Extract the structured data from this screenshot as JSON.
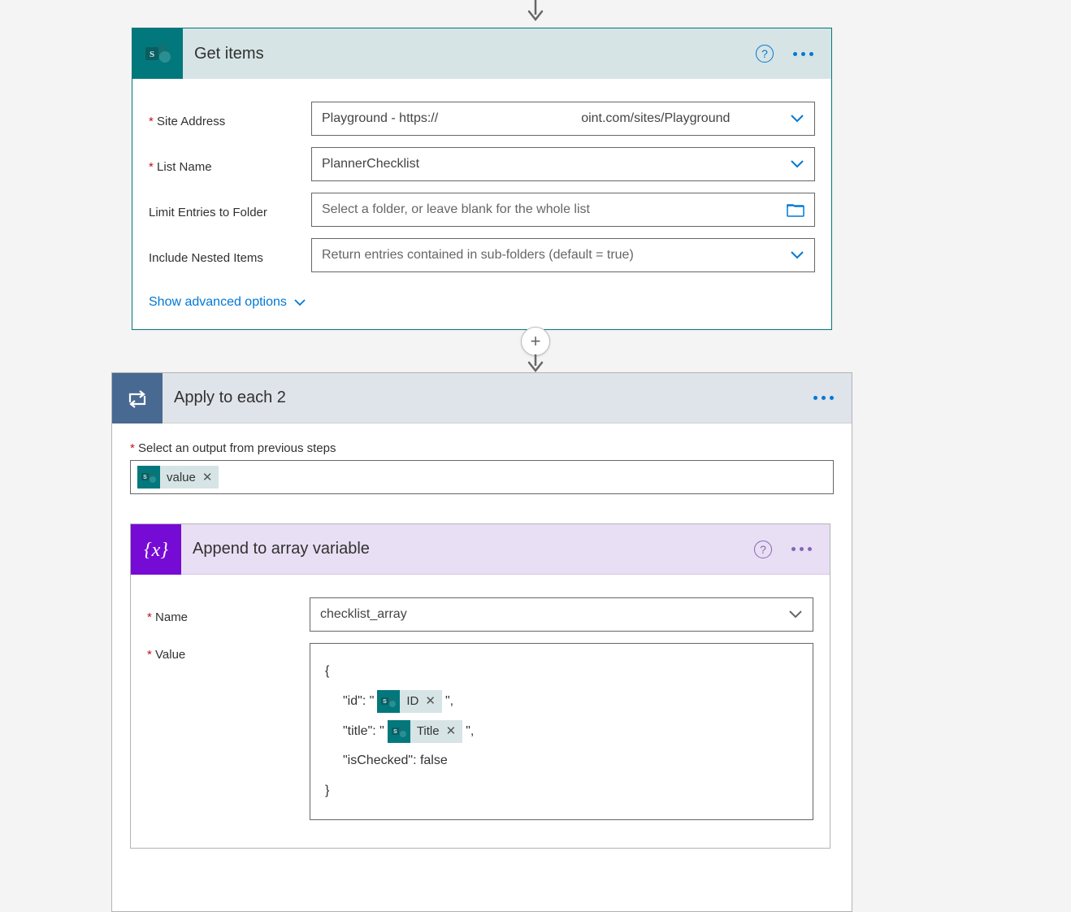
{
  "get_items": {
    "title": "Get items",
    "fields": {
      "site_address": {
        "label": "Site Address",
        "value_left": "Playground - https://",
        "value_right": "oint.com/sites/Playground"
      },
      "list_name": {
        "label": "List Name",
        "value": "PlannerChecklist"
      },
      "limit_folder": {
        "label": "Limit Entries to Folder",
        "placeholder": "Select a folder, or leave blank for the whole list"
      },
      "nested": {
        "label": "Include Nested Items",
        "placeholder": "Return entries contained in sub-folders (default = true)"
      }
    },
    "advanced_link": "Show advanced options"
  },
  "apply_each": {
    "title": "Apply to each 2",
    "output_label": "Select an output from previous steps",
    "token_value": "value"
  },
  "append_array": {
    "title": "Append to array variable",
    "name_label": "Name",
    "name_value": "checklist_array",
    "value_label": "Value",
    "json": {
      "open": "{",
      "id_pre": "\"id\": \"",
      "id_token": "ID",
      "id_post": "\",",
      "title_pre": "\"title\": \"",
      "title_token": "Title",
      "title_post": "\",",
      "checked": "\"isChecked\": false",
      "close": "}"
    }
  }
}
